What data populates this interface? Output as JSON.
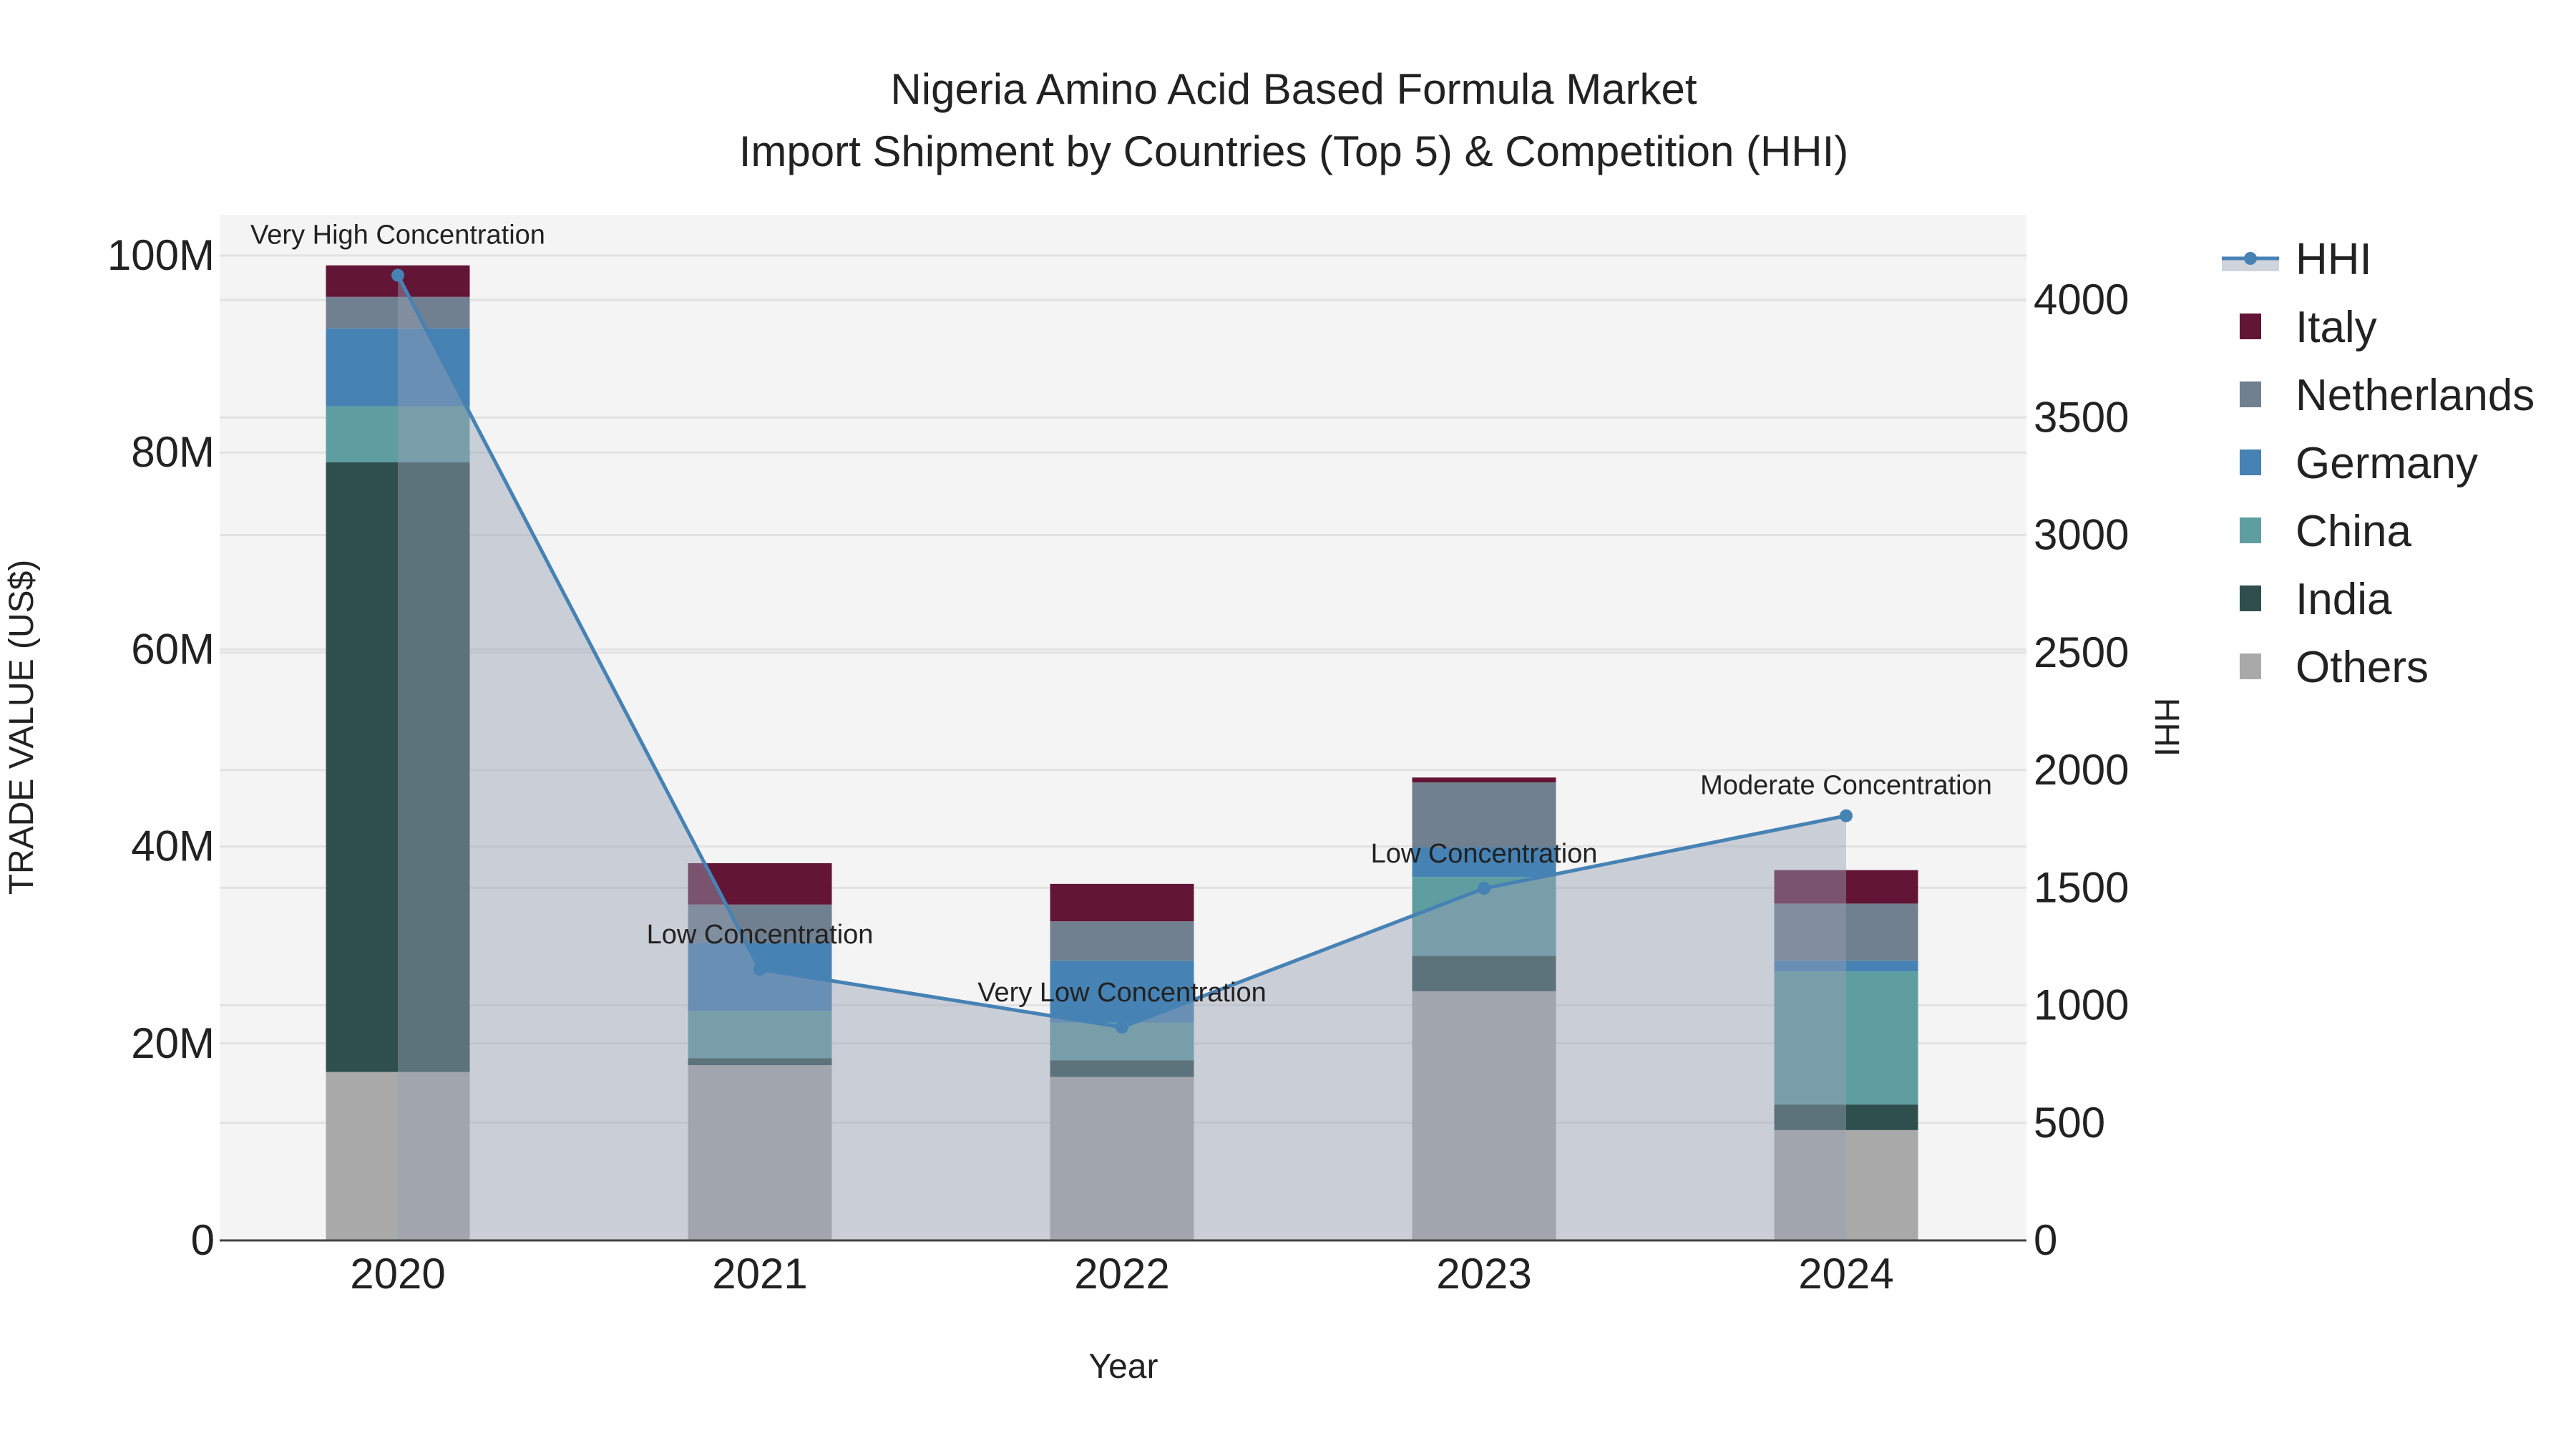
{
  "chart_data": {
    "type": "bar",
    "title_line1": "Nigeria Amino Acid Based Formula Market",
    "title_line2": "Import Shipment by Countries (Top 5) & Competition (HHI)",
    "xlabel": "Year",
    "ylabel": "TRADE VALUE (US$)",
    "y2label": "HHI",
    "categories": [
      "2020",
      "2021",
      "2022",
      "2023",
      "2024"
    ],
    "ylim": [
      0,
      104
    ],
    "y_unit": "M US$",
    "y_ticks": [
      0,
      20,
      40,
      60,
      80,
      100
    ],
    "y_tick_labels": [
      "0",
      "20M",
      "40M",
      "60M",
      "80M",
      "100M"
    ],
    "y2lim": [
      0,
      4360
    ],
    "y2_ticks": [
      0,
      500,
      1000,
      1500,
      2000,
      2500,
      3000,
      3500,
      4000
    ],
    "y2_tick_labels": [
      "0",
      "500",
      "1000",
      "1500",
      "2000",
      "2500",
      "3000",
      "3500",
      "4000"
    ],
    "stacked": true,
    "series": [
      {
        "name": "Others",
        "color": "#a9a9a9",
        "values": [
          17.1,
          17.8,
          16.6,
          25.3,
          11.2
        ]
      },
      {
        "name": "India",
        "color": "#2f4f4f",
        "values": [
          61.9,
          0.7,
          1.7,
          3.6,
          2.6
        ]
      },
      {
        "name": "China",
        "color": "#5f9ea0",
        "values": [
          5.7,
          4.8,
          3.8,
          8.0,
          13.5
        ]
      },
      {
        "name": "Germany",
        "color": "#4682b4",
        "values": [
          7.9,
          6.9,
          6.3,
          3.0,
          1.1
        ]
      },
      {
        "name": "Netherlands",
        "color": "#708090",
        "values": [
          3.2,
          3.9,
          4.0,
          6.6,
          5.8
        ]
      },
      {
        "name": "Italy",
        "color": "#631535",
        "values": [
          3.2,
          4.2,
          3.8,
          0.5,
          3.4
        ]
      }
    ],
    "hhi": {
      "name": "HHI",
      "color": "#4682b4",
      "values": [
        4105,
        1153,
        907,
        1497,
        1806
      ],
      "annotations": [
        "Very High Concentration",
        "Low Concentration",
        "Very Low Concentration",
        "Low Concentration",
        "Moderate Concentration"
      ]
    },
    "legend_order": [
      "HHI",
      "Italy",
      "Netherlands",
      "Germany",
      "China",
      "India",
      "Others"
    ],
    "legend_placement": "right",
    "grid": true
  }
}
